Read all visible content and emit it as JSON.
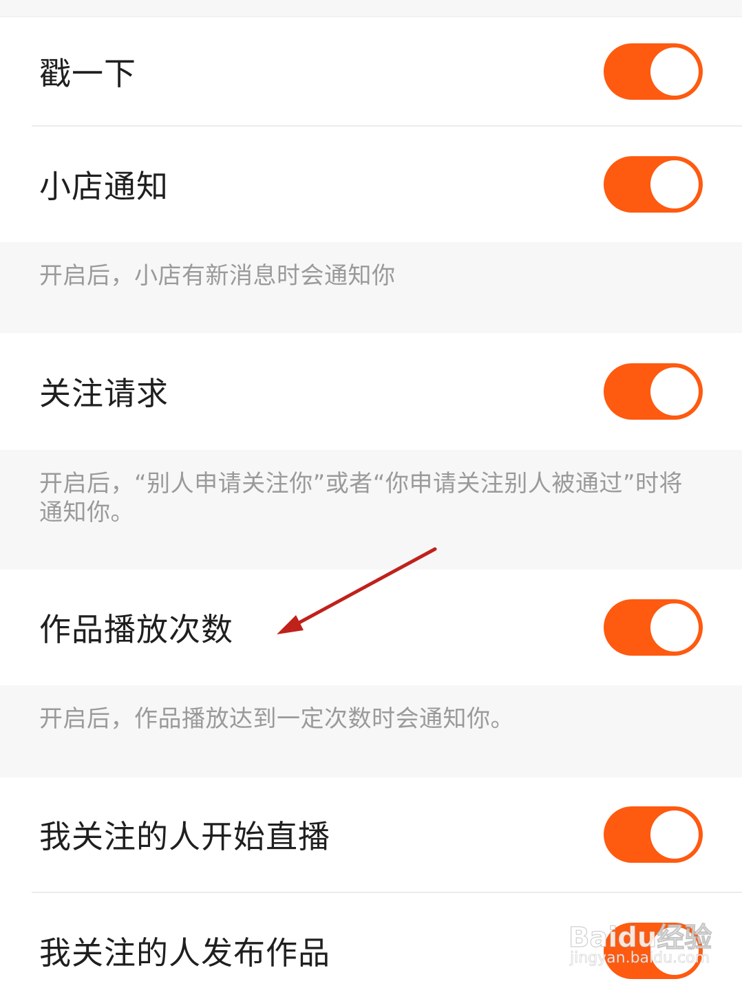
{
  "settings": {
    "items": [
      {
        "label": "戳一下",
        "enabled": true
      },
      {
        "label": "小店通知",
        "enabled": true,
        "description": "开启后，小店有新消息时会通知你"
      },
      {
        "label": "关注请求",
        "enabled": true,
        "description": "开启后，“别人申请关注你”或者“你申请关注别人被通过”时将通知你。"
      },
      {
        "label": "作品播放次数",
        "enabled": true,
        "description": "开启后，作品播放达到一定次数时会通知你。"
      },
      {
        "label": "我关注的人开始直播",
        "enabled": true
      },
      {
        "label": "我关注的人发布作品",
        "enabled": true
      }
    ]
  },
  "colors": {
    "toggle_on": "#fe5a10",
    "annotation_arrow": "#c0211b"
  },
  "watermark": {
    "brand": "Baidu经验",
    "url": "jingyan.baidu.com"
  }
}
